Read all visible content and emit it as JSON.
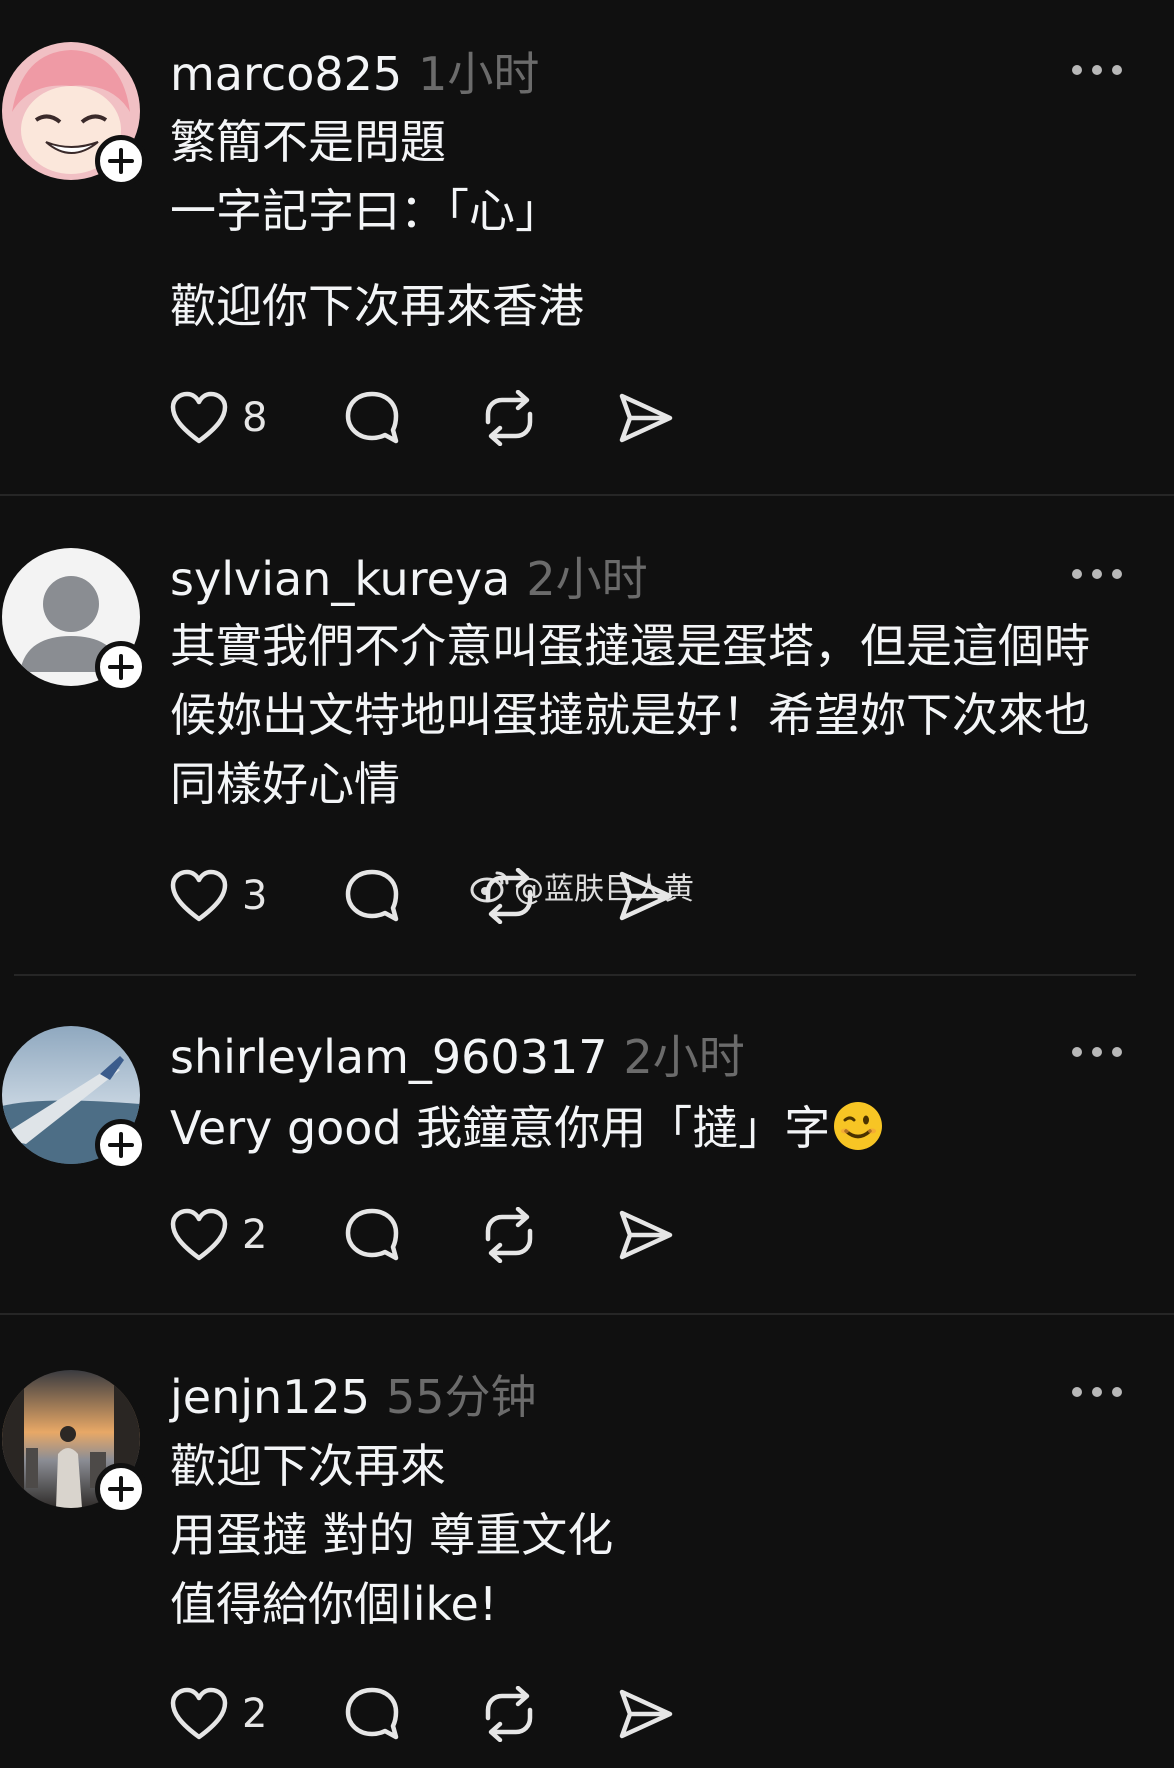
{
  "posts": [
    {
      "username": "marco825",
      "time": "1小时",
      "lines": [
        "繁簡不是問題",
        "一字記字曰：「心」",
        "",
        "歡迎你下次再來香港"
      ],
      "likes": "8"
    },
    {
      "username": "sylvian_kureya",
      "time": "2小时",
      "lines": [
        "其實我們不介意叫蛋撻還是蛋塔，但是這個時",
        "候妳出文特地叫蛋撻就是好！希望妳下次來也",
        "同樣好心情"
      ],
      "likes": "3"
    },
    {
      "username": "shirleylam_960317",
      "time": "2小时",
      "lines": [
        "Very good 我鐘意你用「撻」字"
      ],
      "likes": "2"
    },
    {
      "username": "jenjn125",
      "time": "55分钟",
      "lines": [
        "歡迎下次再來",
        "用蛋撻 對的 尊重文化",
        "值得給你個like!"
      ],
      "likes": "2"
    }
  ],
  "watermark": "@蓝肤巨人黄",
  "icons": {
    "like": "heart-icon",
    "reply": "comment-bubble-icon",
    "repost": "repost-icon",
    "share": "send-icon",
    "more": "more-dots-icon",
    "follow": "plus-icon",
    "emoji": "wink-emoji"
  },
  "colors": {
    "background": "#101010",
    "primary_text": "#f3f5f7",
    "secondary_text": "#6b6b6b",
    "divider": "#262626"
  }
}
